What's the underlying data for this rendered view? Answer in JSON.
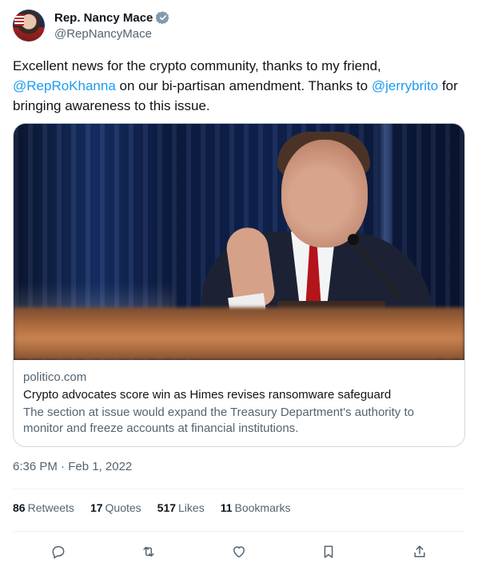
{
  "author": {
    "display_name": "Rep. Nancy Mace",
    "handle": "@RepNancyMace",
    "verified_icon": "verified-badge-icon"
  },
  "tweet": {
    "text_parts": [
      "Excellent news for the crypto community, thanks to my friend, ",
      "@RepRoKhanna",
      " on our bi-partisan amendment. Thanks to ",
      "@jerrybrito",
      " for bringing awareness to this issue."
    ]
  },
  "card": {
    "domain": "politico.com",
    "title": "Crypto advocates score win as Himes revises ransomware safeguard",
    "description": "The section at issue would expand the Treasury Department's authority to monitor and freeze accounts at financial institutions."
  },
  "timestamp": "6:36 PM · Feb 1, 2022",
  "stats": {
    "retweets_count": "86",
    "retweets_label": "Retweets",
    "quotes_count": "17",
    "quotes_label": "Quotes",
    "likes_count": "517",
    "likes_label": "Likes",
    "bookmarks_count": "11",
    "bookmarks_label": "Bookmarks"
  },
  "actions": {
    "icons": [
      "reply-icon",
      "retweet-icon",
      "like-icon",
      "bookmark-icon",
      "share-icon"
    ]
  },
  "colors": {
    "link": "#1d9bf0",
    "secondary_text": "#536471",
    "primary_text": "#0f1419",
    "border": "#cfd9de",
    "verified": "#829aab"
  }
}
